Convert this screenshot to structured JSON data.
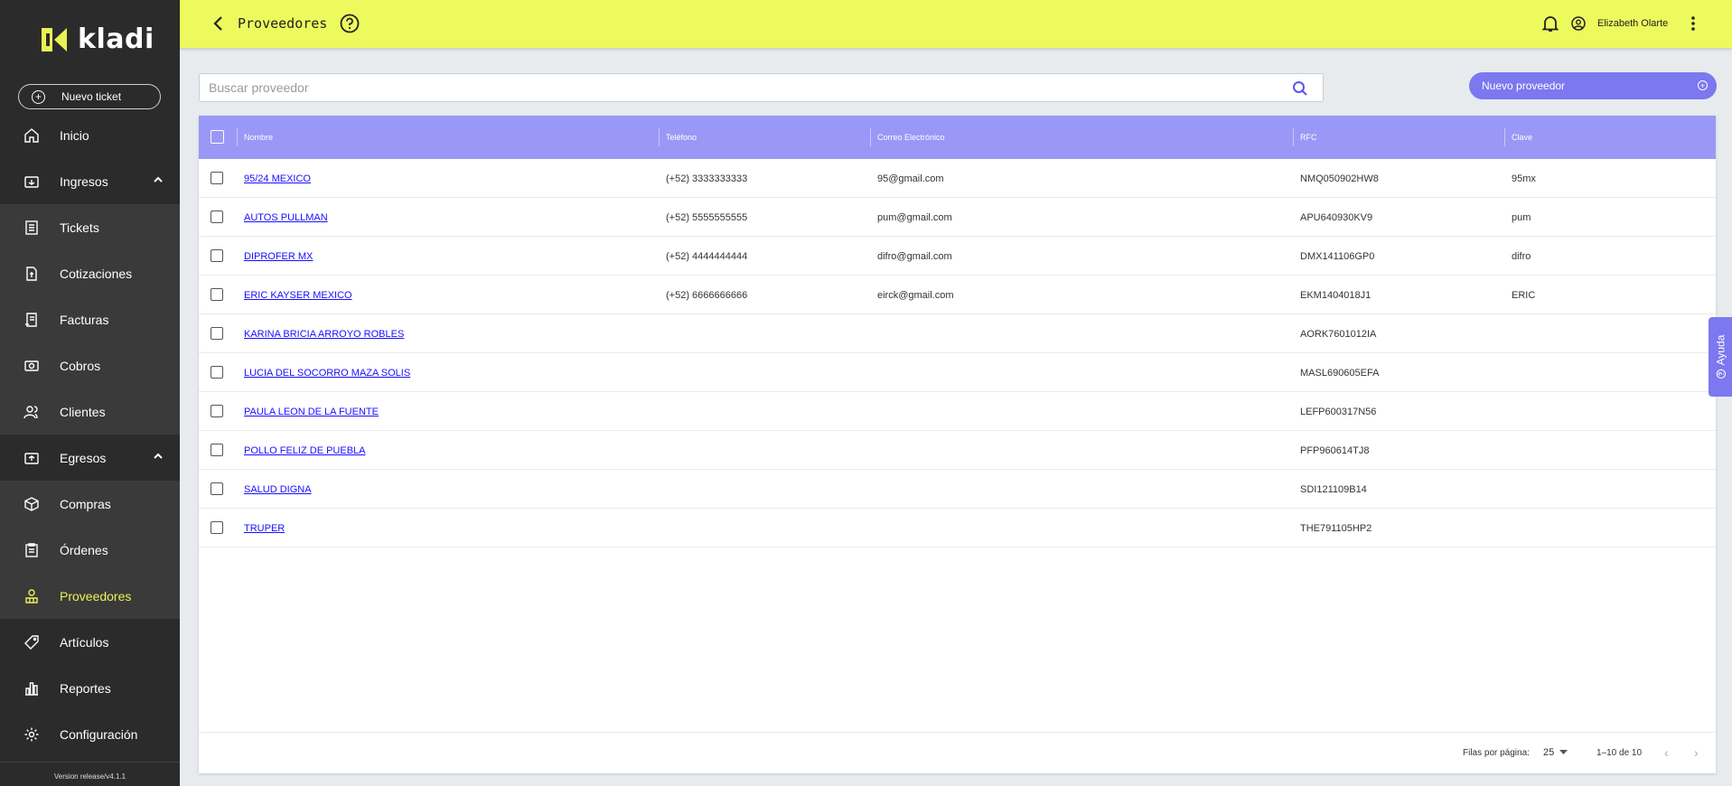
{
  "app": {
    "logo_text": "kladi",
    "version": "Version release/v4.1.1"
  },
  "sidebar": {
    "new_ticket_label": "Nuevo ticket",
    "items": [
      {
        "label": "Inicio",
        "icon": "home-icon"
      },
      {
        "label": "Ingresos",
        "icon": "income-icon"
      },
      {
        "label": "Tickets",
        "icon": "ticket-icon"
      },
      {
        "label": "Cotizaciones",
        "icon": "quote-icon"
      },
      {
        "label": "Facturas",
        "icon": "invoice-icon"
      },
      {
        "label": "Cobros",
        "icon": "cash-icon"
      },
      {
        "label": "Clientes",
        "icon": "clients-icon"
      },
      {
        "label": "Egresos",
        "icon": "expenses-icon"
      },
      {
        "label": "Compras",
        "icon": "box-icon"
      },
      {
        "label": "Órdenes",
        "icon": "orders-icon"
      },
      {
        "label": "Proveedores",
        "icon": "supplier-icon"
      },
      {
        "label": "Artículos",
        "icon": "tag-icon"
      },
      {
        "label": "Reportes",
        "icon": "reports-icon"
      },
      {
        "label": "Configuración",
        "icon": "gear-icon"
      }
    ]
  },
  "header": {
    "title": "Proveedores",
    "user_name": "Elizabeth Olarte"
  },
  "search": {
    "placeholder": "Buscar proveedor"
  },
  "actions": {
    "new_supplier_label": "Nuevo proveedor"
  },
  "table": {
    "columns": [
      "Nombre",
      "Teléfono",
      "Correo Electrónico",
      "RFC",
      "Clave"
    ],
    "rows": [
      [
        "95/24 MEXICO",
        "(+52) 3333333333",
        "95@gmail.com",
        "NMQ050902HW8",
        "95mx"
      ],
      [
        "AUTOS PULLMAN",
        "(+52) 5555555555",
        "pum@gmail.com",
        "APU640930KV9",
        "pum"
      ],
      [
        "DIPROFER MX",
        "(+52) 4444444444",
        "difro@gmail.com",
        "DMX141106GP0",
        "difro"
      ],
      [
        "ERIC KAYSER MEXICO",
        "(+52) 6666666666",
        "eirck@gmail.com",
        "EKM1404018J1",
        "ERIC"
      ],
      [
        "KARINA BRICIA ARROYO ROBLES",
        "",
        "",
        "AORK7601012IA",
        ""
      ],
      [
        "LUCIA DEL SOCORRO MAZA SOLIS",
        "",
        "",
        "MASL690605EFA",
        ""
      ],
      [
        "PAULA LEON DE LA FUENTE",
        "",
        "",
        "LEFP600317N56",
        ""
      ],
      [
        "POLLO FELIZ DE PUEBLA",
        "",
        "",
        "PFP960614TJ8",
        ""
      ],
      [
        "SALUD DIGNA",
        "",
        "",
        "SDI121109B14",
        ""
      ],
      [
        "TRUPER",
        "",
        "",
        "THE791105HP2",
        ""
      ]
    ]
  },
  "pagination": {
    "rows_per_page_label": "Filas por página:",
    "rows_per_page": "25",
    "range": "1–10 de 10"
  },
  "help_tab": {
    "label": "Ayuda"
  },
  "colors": {
    "topbar": "#edfa5d",
    "sidebar": "#2b2b2b",
    "accent": "#7b78f0",
    "table_header": "#9a98f6",
    "active_nav": "#e9f355"
  }
}
